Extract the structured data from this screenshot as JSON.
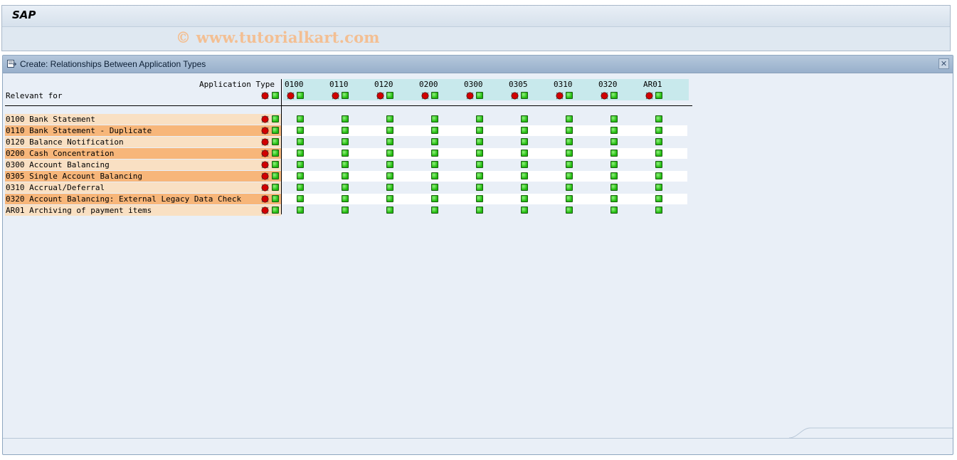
{
  "app": {
    "title": "SAP",
    "watermark": "© www.tutorialkart.com"
  },
  "window": {
    "title": "Create: Relationships Between Application Types",
    "close_label": "✕"
  },
  "grid": {
    "column_header_label": "Application Type",
    "row_header_label": "Relevant for",
    "columns": [
      "0100",
      "0110",
      "0120",
      "0200",
      "0300",
      "0305",
      "0310",
      "0320",
      "AR01"
    ],
    "rows": [
      {
        "code": "0100",
        "text": "0100 Bank Statement"
      },
      {
        "code": "0110",
        "text": "0110 Bank Statement - Duplicate"
      },
      {
        "code": "0120",
        "text": "0120 Balance Notification"
      },
      {
        "code": "0200",
        "text": "0200 Cash Concentration"
      },
      {
        "code": "0300",
        "text": "0300 Account Balancing"
      },
      {
        "code": "0305",
        "text": "0305 Single Account Balancing"
      },
      {
        "code": "0310",
        "text": "0310 Accrual/Deferral"
      },
      {
        "code": "0320",
        "text": "0320 Account Balancing: External Legacy Data Check"
      },
      {
        "code": "AR01",
        "text": "AR01 Archiving of payment items"
      }
    ],
    "cell_state": "selected",
    "icons": {
      "deselect": "deselect-all-icon",
      "select": "select-all-icon",
      "cell": "checkbox-selected-icon"
    },
    "colors": {
      "header_band": "#c8e9ec",
      "row_light": "#f9e0c3",
      "row_dark": "#f7b67a",
      "green": "#1fb80c",
      "red": "#d10000"
    }
  }
}
